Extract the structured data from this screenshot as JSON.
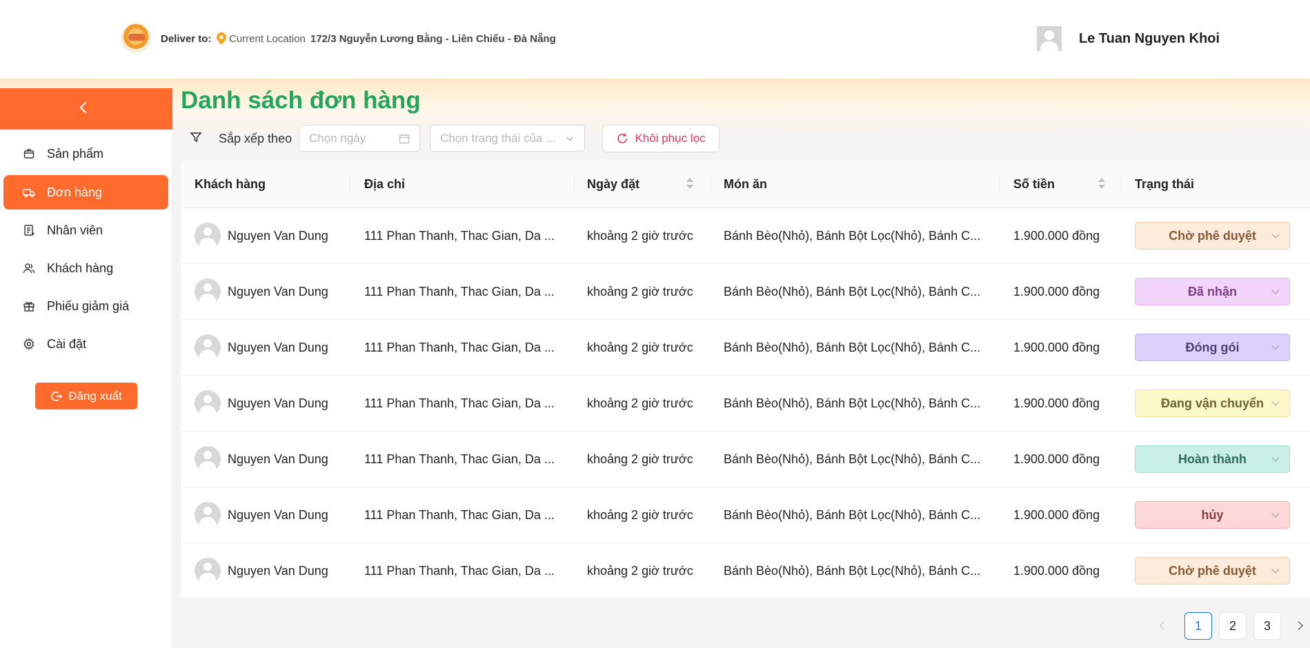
{
  "header": {
    "deliver_label": "Deliver to:",
    "location_label": "Current Location",
    "address": "172/3 Nguyễn Lương Bằng - Liên Chiểu - Đà Nẵng",
    "user_name": "Le Tuan Nguyen Khoi"
  },
  "sidebar": {
    "items": [
      {
        "label": "Sản phẩm",
        "icon": "box-icon"
      },
      {
        "label": "Đơn hàng",
        "icon": "truck-icon",
        "active": true
      },
      {
        "label": "Nhân viên",
        "icon": "clipboard-icon"
      },
      {
        "label": "Khách hàng",
        "icon": "users-icon"
      },
      {
        "label": "Phiếu giảm giá",
        "icon": "gift-icon"
      },
      {
        "label": "Cài đặt",
        "icon": "gear-icon"
      }
    ],
    "logout_label": "Đăng xuất"
  },
  "main": {
    "title": "Danh sách đơn hàng",
    "filters": {
      "sort_label": "Sắp xếp theo",
      "date_placeholder": "Chọn ngày",
      "status_placeholder": "Chọn trạng thái của ...",
      "reset_label": "Khôi phục lọc"
    }
  },
  "table": {
    "columns": [
      "Khách hàng",
      "Địa chỉ",
      "Ngày đặt",
      "Món ăn",
      "Số tiền",
      "Trạng thái"
    ],
    "rows": [
      {
        "customer": "Nguyen Van Dung",
        "address": "111 Phan Thanh, Thac Gian, Da ...",
        "date": "khoảng 2 giờ trước",
        "dishes": "Bánh Bèo(Nhỏ), Bánh Bột Lọc(Nhỏ), Bánh C...",
        "amount": "1.900.000 đồng",
        "status": "Chờ phê duyệt",
        "status_bg": "#fdebdb",
        "status_border": "#f3cba6",
        "status_color": "#8a5a34"
      },
      {
        "customer": "Nguyen Van Dung",
        "address": "111 Phan Thanh, Thac Gian, Da ...",
        "date": "khoảng 2 giờ trước",
        "dishes": "Bánh Bèo(Nhỏ), Bánh Bột Lọc(Nhỏ), Bánh C...",
        "amount": "1.900.000 đồng",
        "status": "Đã nhận",
        "status_bg": "#f3d4fb",
        "status_border": "#e3b3f0",
        "status_color": "#7a3f8c"
      },
      {
        "customer": "Nguyen Van Dung",
        "address": "111 Phan Thanh, Thac Gian, Da ...",
        "date": "khoảng 2 giờ trước",
        "dishes": "Bánh Bèo(Nhỏ), Bánh Bột Lọc(Nhỏ), Bánh C...",
        "amount": "1.900.000 đồng",
        "status": "Đóng gói",
        "status_bg": "#dcd1fb",
        "status_border": "#c2b3f2",
        "status_color": "#4b3f7a"
      },
      {
        "customer": "Nguyen Van Dung",
        "address": "111 Phan Thanh, Thac Gian, Da ...",
        "date": "khoảng 2 giờ trước",
        "dishes": "Bánh Bèo(Nhỏ), Bánh Bột Lọc(Nhỏ), Bánh C...",
        "amount": "1.900.000 đồng",
        "status": "Đang vận chuyển",
        "status_bg": "#fdf8c9",
        "status_border": "#efe39a",
        "status_color": "#6e6330"
      },
      {
        "customer": "Nguyen Van Dung",
        "address": "111 Phan Thanh, Thac Gian, Da ...",
        "date": "khoảng 2 giờ trước",
        "dishes": "Bánh Bèo(Nhỏ), Bánh Bột Lọc(Nhỏ), Bánh C...",
        "amount": "1.900.000 đồng",
        "status": "Hoàn thành",
        "status_bg": "#c9f0e6",
        "status_border": "#9fdfcf",
        "status_color": "#2f6b5c"
      },
      {
        "customer": "Nguyen Van Dung",
        "address": "111 Phan Thanh, Thac Gian, Da ...",
        "date": "khoảng 2 giờ trước",
        "dishes": "Bánh Bèo(Nhỏ), Bánh Bột Lọc(Nhỏ), Bánh C...",
        "amount": "1.900.000 đồng",
        "status": "hủy",
        "status_bg": "#fdd8d8",
        "status_border": "#f3b2b2",
        "status_color": "#8a3c3c"
      },
      {
        "customer": "Nguyen Van Dung",
        "address": "111 Phan Thanh, Thac Gian, Da ...",
        "date": "khoảng 2 giờ trước",
        "dishes": "Bánh Bèo(Nhỏ), Bánh Bột Lọc(Nhỏ), Bánh C...",
        "amount": "1.900.000 đồng",
        "status": "Chờ phê duyệt",
        "status_bg": "#fdebdb",
        "status_border": "#f3cba6",
        "status_color": "#8a5a34"
      }
    ]
  },
  "pagination": {
    "pages": [
      "1",
      "2",
      "3"
    ],
    "current": "1"
  },
  "colors": {
    "accent": "#ff6b2c",
    "title_green": "#25a55a",
    "reset_red": "#e7375a",
    "page_active": "#1677ff"
  }
}
